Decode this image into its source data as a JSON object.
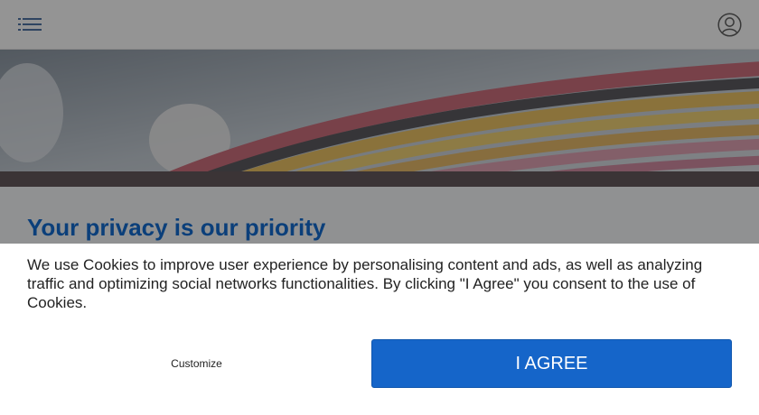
{
  "header": {
    "menu_icon": "list-menu-icon",
    "account_icon": "user-circle-icon"
  },
  "main": {
    "heading": "Your privacy is our priority"
  },
  "cookie_banner": {
    "message": "We use Cookies to improve user experience by personalising content and ads, as well as analyzing traffic and optimizing social networks functionalities. By clicking \"I Agree\" you consent to the use of Cookies.",
    "customize_label": "Customize",
    "agree_label": "I AGREE"
  },
  "colors": {
    "heading": "#0b3f7a",
    "agree_button": "#1565c9",
    "menu_icon": "#1f4e8f"
  }
}
